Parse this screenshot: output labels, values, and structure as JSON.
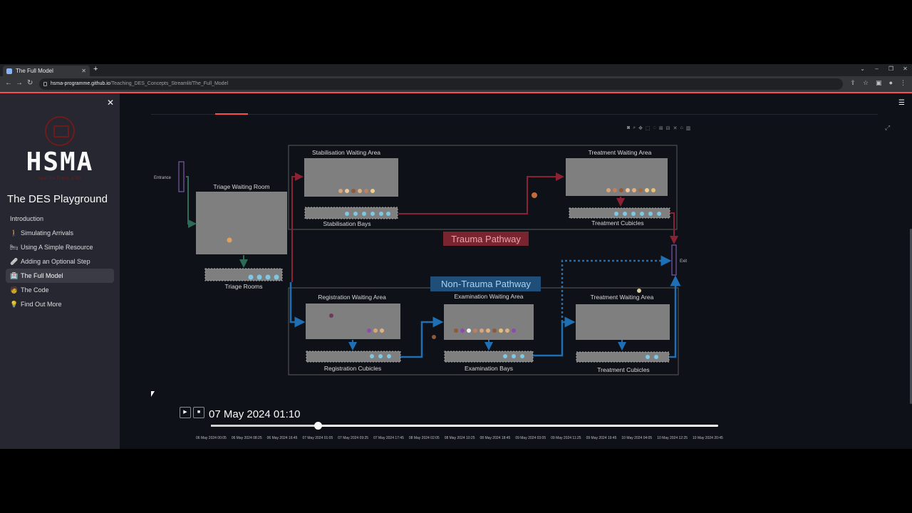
{
  "browser": {
    "tab_title": "The Full Model",
    "url_host": "hsma-programme.github.io",
    "url_path": "/Teaching_DES_Concepts_Streamlit/The_Full_Model"
  },
  "sidebar": {
    "logo_text": "HSMA",
    "logo_subtext": "Heal The Future, A Tes",
    "title": "The DES Playground",
    "items": [
      {
        "label": "Introduction",
        "icon": ""
      },
      {
        "label": "Simulating Arrivals",
        "icon": "walking-person-icon"
      },
      {
        "label": "Using A Simple Resource",
        "icon": "bed-icon"
      },
      {
        "label": "Adding an Optional Step",
        "icon": "bandage-icon"
      },
      {
        "label": "The Full Model",
        "icon": "hospital-icon"
      },
      {
        "label": "The Code",
        "icon": "technologist-icon"
      },
      {
        "label": "Find Out More",
        "icon": "lightbulb-icon"
      }
    ],
    "active_item": "The Full Model"
  },
  "diagram": {
    "entrance_label": "Entrance",
    "exit_label": "Exit",
    "triage_waiting": "Triage Waiting Room",
    "triage_rooms": "Triage Rooms",
    "stab_waiting": "Stabilisation Waiting Area",
    "stab_bays": "Stabilisation Bays",
    "trauma_treat_waiting": "Treatment Waiting Area",
    "trauma_treat_cubicles": "Treatment Cubicles",
    "trauma_pathway": "Trauma Pathway",
    "nontrauma_pathway": "Non-Trauma Pathway",
    "reg_waiting": "Registration Waiting Area",
    "reg_cubicles": "Registration Cubicles",
    "exam_waiting": "Examination Waiting Area",
    "exam_bays": "Examination Bays",
    "nt_treat_waiting": "Treatment Waiting Area",
    "nt_treat_cubicles": "Treatment Cubicles",
    "colors": {
      "trauma": "#8b2234",
      "nontrauma": "#1f6fb4",
      "triage_flow": "#2e6b57",
      "area_fill": "#7f7f7f"
    }
  },
  "player": {
    "play_icon": "play-icon",
    "stop_icon": "stop-icon",
    "current_frame": "07 May 2024 01:10",
    "progress": 0.2107,
    "ticks": [
      "06 May 2024 00:05",
      "06 May 2024 08:25",
      "06 May 2024 16:45",
      "07 May 2024 01:05",
      "07 May 2024 09:25",
      "07 May 2024 17:45",
      "08 May 2024 02:05",
      "08 May 2024 10:25",
      "08 May 2024 18:45",
      "09 May 2024 03:05",
      "09 May 2024 11:25",
      "09 May 2024 19:45",
      "10 May 2024 04:05",
      "10 May 2024 12:25",
      "10 May 2024 20:45"
    ]
  }
}
